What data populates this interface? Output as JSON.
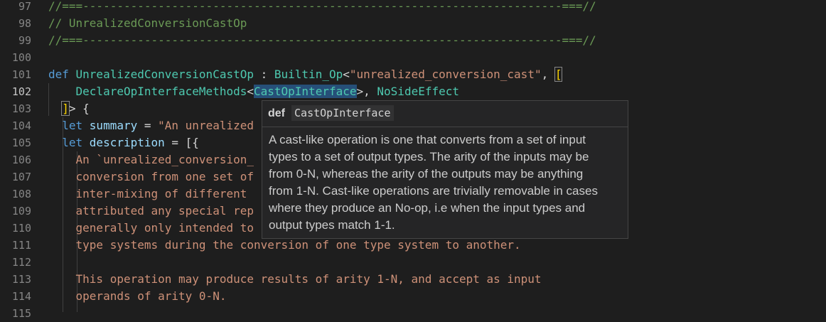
{
  "editor": {
    "lines": [
      {
        "num": "97",
        "parts": [
          {
            "t": "//===----------------------------------------------------------------------===//",
            "c": "cm"
          }
        ]
      },
      {
        "num": "98",
        "parts": [
          {
            "t": "// UnrealizedConversionCastOp",
            "c": "cm"
          }
        ]
      },
      {
        "num": "99",
        "parts": [
          {
            "t": "//===----------------------------------------------------------------------===//",
            "c": "cm"
          }
        ]
      },
      {
        "num": "100",
        "parts": []
      },
      {
        "num": "101",
        "parts": [
          {
            "t": "def ",
            "c": "kw"
          },
          {
            "t": "UnrealizedConversionCastOp",
            "c": "cls"
          },
          {
            "t": " : ",
            "c": "pl"
          },
          {
            "t": "Builtin_Op",
            "c": "cls"
          },
          {
            "t": "<",
            "c": "pl"
          },
          {
            "t": "\"unrealized_conversion_cast\"",
            "c": "str"
          },
          {
            "t": ", ",
            "c": "pl"
          },
          {
            "t": "[",
            "c": "br"
          }
        ]
      },
      {
        "num": "102",
        "active": true,
        "parts": [
          {
            "t": "    ",
            "c": "pl"
          },
          {
            "t": "DeclareOpInterfaceMethods",
            "c": "cls"
          },
          {
            "t": "<",
            "c": "pl"
          },
          {
            "t": "CastOpInterface",
            "c": "cls hl"
          },
          {
            "t": ">, ",
            "c": "pl"
          },
          {
            "t": "NoSideEffect",
            "c": "cls"
          }
        ]
      },
      {
        "num": "103",
        "parts": [
          {
            "t": "  ",
            "c": "pl"
          },
          {
            "t": "]",
            "c": "br"
          },
          {
            "t": "> {",
            "c": "pl"
          }
        ]
      },
      {
        "num": "104",
        "parts": [
          {
            "t": "  ",
            "c": "pl"
          },
          {
            "t": "let ",
            "c": "kw"
          },
          {
            "t": "summary",
            "c": "id"
          },
          {
            "t": " = ",
            "c": "pl"
          },
          {
            "t": "\"An unrealized",
            "c": "str"
          }
        ]
      },
      {
        "num": "105",
        "parts": [
          {
            "t": "  ",
            "c": "pl"
          },
          {
            "t": "let ",
            "c": "kw"
          },
          {
            "t": "description",
            "c": "id"
          },
          {
            "t": " = [{",
            "c": "pl"
          }
        ]
      },
      {
        "num": "106",
        "parts": [
          {
            "t": "    An `unrealized_conversion_",
            "c": "str"
          }
        ]
      },
      {
        "num": "107",
        "parts": [
          {
            "t": "    conversion from one set of",
            "c": "str"
          }
        ]
      },
      {
        "num": "108",
        "parts": [
          {
            "t": "    inter-mixing of different",
            "c": "str"
          }
        ]
      },
      {
        "num": "109",
        "parts": [
          {
            "t": "    attributed any special rep",
            "c": "str"
          }
        ]
      },
      {
        "num": "110",
        "parts": [
          {
            "t": "    generally only intended to",
            "c": "str"
          }
        ]
      },
      {
        "num": "111",
        "parts": [
          {
            "t": "    type systems during the conversion of one type system to another.",
            "c": "str"
          }
        ]
      },
      {
        "num": "112",
        "parts": []
      },
      {
        "num": "113",
        "parts": [
          {
            "t": "    This operation may produce results of arity 1-N, and accept as input",
            "c": "str"
          }
        ]
      },
      {
        "num": "114",
        "parts": [
          {
            "t": "    operands of arity 0-N.",
            "c": "str"
          }
        ]
      },
      {
        "num": "115",
        "parts": []
      }
    ]
  },
  "hover": {
    "keyword": "def",
    "name": "CastOpInterface",
    "lines": [
      "A cast-like operation is one that converts from a set of input",
      "types to a set of output types. The arity of the inputs may be",
      "from 0-N, whereas the arity of the outputs may be anything",
      "from 1-N. Cast-like operations are trivially removable in cases",
      "where they produce an No-op, i.e when the input types and",
      "output types match 1-1."
    ]
  }
}
